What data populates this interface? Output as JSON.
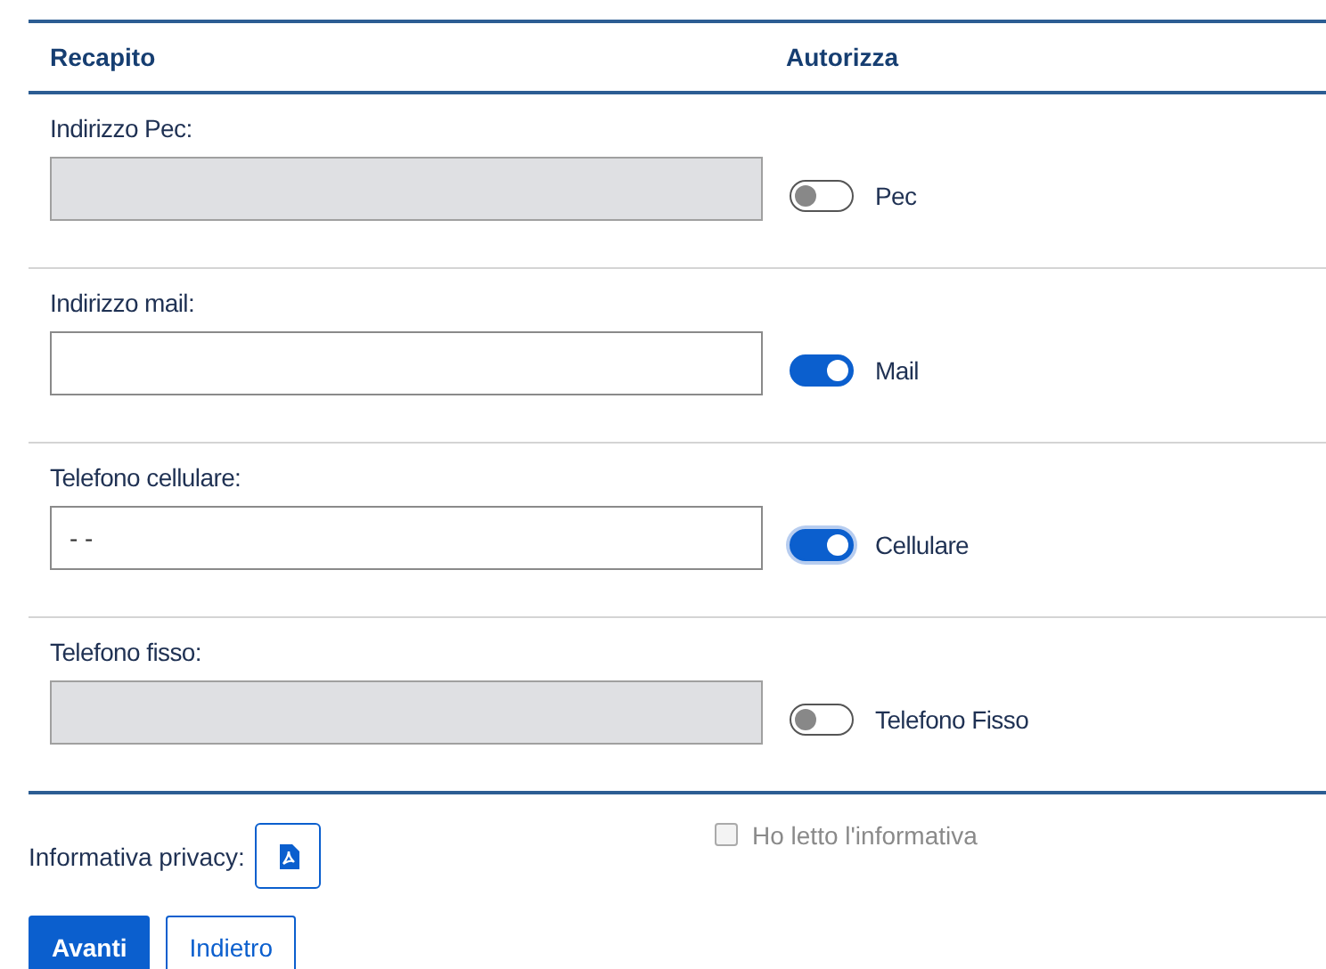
{
  "table": {
    "columns": [
      "Recapito",
      "Autorizza"
    ],
    "rows": [
      {
        "label": "Indirizzo Pec:",
        "disabled": true,
        "toggle": {
          "label": "Pec",
          "on": false,
          "focused": false
        }
      },
      {
        "label": "Indirizzo mail:",
        "disabled": false,
        "toggle": {
          "label": "Mail",
          "on": true,
          "focused": false
        }
      },
      {
        "label": "Telefono cellulare:",
        "disabled": false,
        "value": "- -",
        "toggle": {
          "label": "Cellulare",
          "on": true,
          "focused": true
        }
      },
      {
        "label": "Telefono fisso:",
        "disabled": true,
        "toggle": {
          "label": "Telefono Fisso",
          "on": false,
          "focused": false
        }
      }
    ]
  },
  "privacy": {
    "label": "Informativa privacy:",
    "checkbox": {
      "label": "Ho letto l'informativa",
      "checked": false,
      "disabled": true
    }
  },
  "buttons": [
    {
      "label": "Avanti",
      "kind": "primary"
    },
    {
      "label": "Indietro",
      "kind": "secondary"
    }
  ]
}
